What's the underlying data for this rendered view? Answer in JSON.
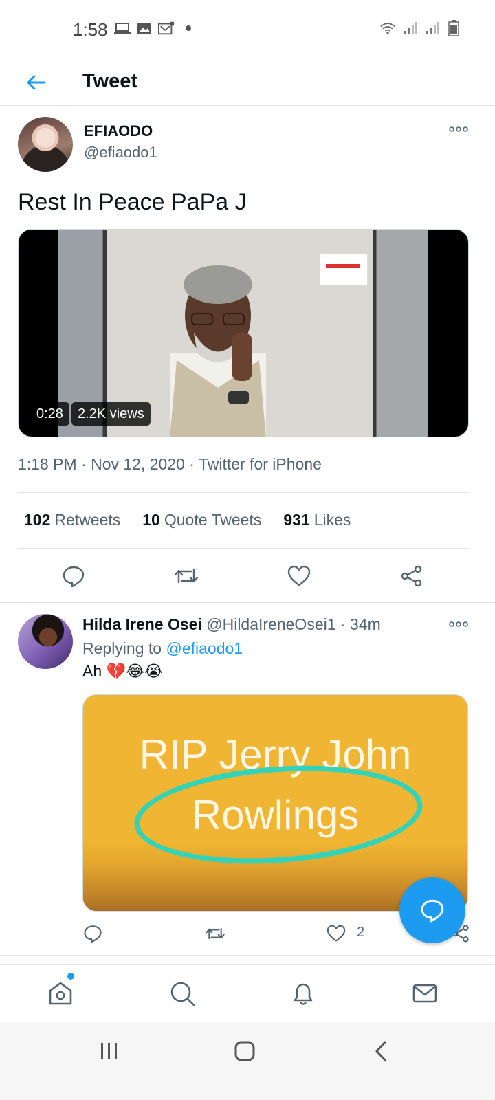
{
  "status_bar": {
    "time": "1:58",
    "left_icons": [
      "laptop-icon",
      "image-icon",
      "gallery-icon",
      "dot-icon"
    ],
    "right_icons": [
      "wifi-icon",
      "signal-icon",
      "signal-icon",
      "battery-icon"
    ]
  },
  "header": {
    "title": "Tweet"
  },
  "tweet": {
    "author_name": "EFIAODO",
    "author_handle": "@efiaodo1",
    "text": "Rest In Peace PaPa J",
    "video_duration": "0:28",
    "video_views": "2.2K views",
    "meta": "1:18 PM · Nov 12, 2020 · Twitter for iPhone",
    "stats": {
      "retweets_count": "102",
      "retweets_label": "Retweets",
      "quotes_count": "10",
      "quotes_label": "Quote Tweets",
      "likes_count": "931",
      "likes_label": "Likes"
    }
  },
  "reply": {
    "name": "Hilda Irene Osei",
    "handle": "@HildaIreneOsei1",
    "dot": "·",
    "time": "34m",
    "replying_prefix": "Replying to",
    "replying_to": "@efiaodo1",
    "text": "Ah 💔😂😭",
    "image_line1": "RIP Jerry John",
    "image_line2": "Rowlings",
    "like_count": "2"
  },
  "colors": {
    "accent": "#1d9bf0",
    "text": "#0f1419",
    "secondary": "#536471",
    "divider": "#dfe3e6"
  }
}
